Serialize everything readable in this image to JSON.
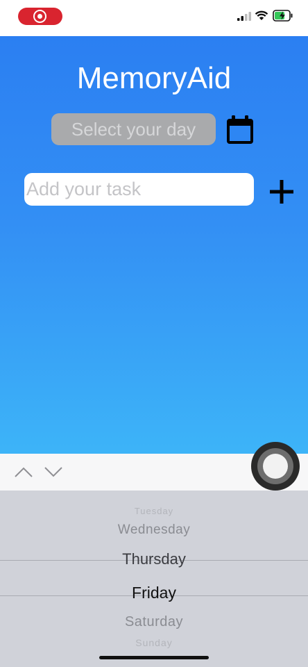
{
  "status_bar": {
    "recording_indicator": "screen-recording-icon",
    "icons": [
      "cellular-signal-icon",
      "wifi-icon",
      "battery-charging-icon"
    ]
  },
  "colors": {
    "gradient_top": "#2b7ff2",
    "gradient_bottom": "#3db4f8",
    "record_red": "#d9242f",
    "select_bg": "#a9aaac"
  },
  "header": {
    "title": "MemoryAid"
  },
  "day_select": {
    "placeholder": "Select your day",
    "icon": "calendar-icon"
  },
  "task": {
    "placeholder": "Add your task",
    "add_icon": "plus-icon"
  },
  "keyboard_accessory": {
    "icons": [
      "chevron-up-icon",
      "chevron-down-icon"
    ]
  },
  "picker": {
    "items": [
      "Tuesday",
      "Wednesday",
      "Thursday",
      "Friday",
      "Saturday",
      "Sunday"
    ],
    "selected": "Friday"
  }
}
